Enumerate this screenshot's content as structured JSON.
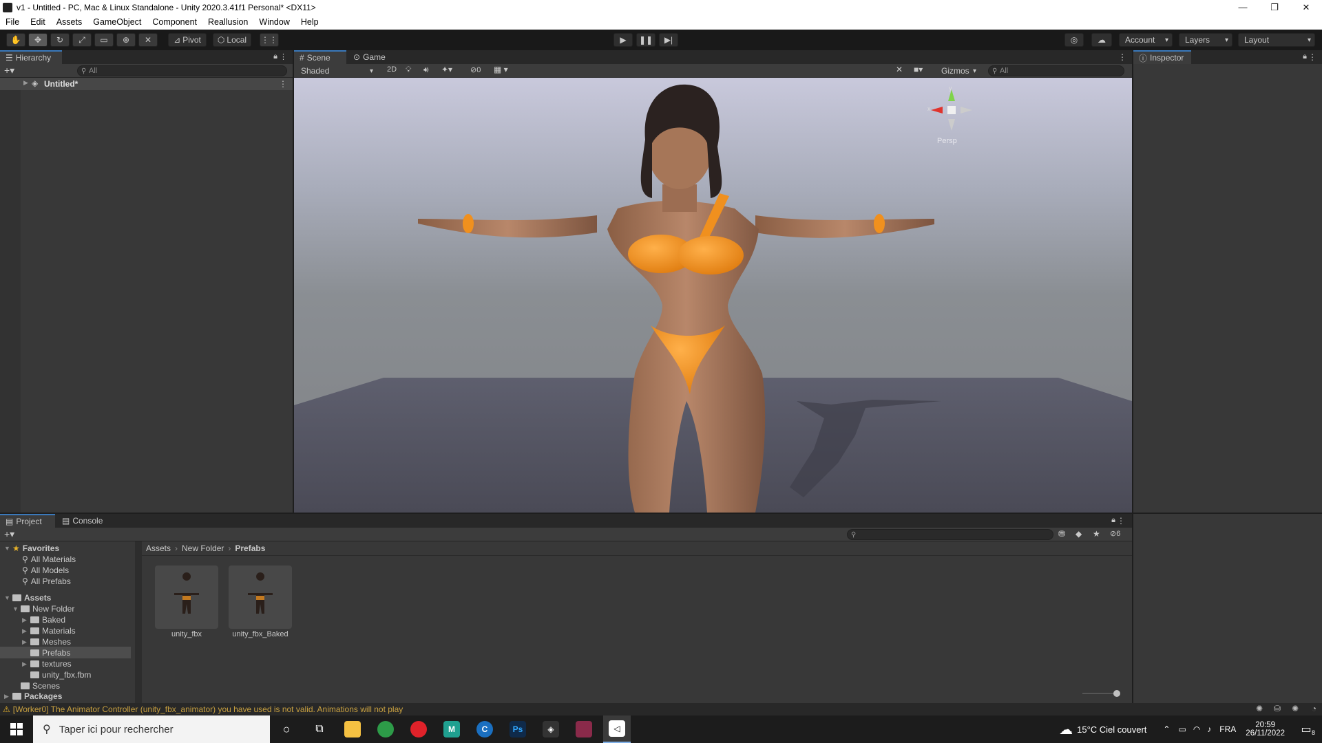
{
  "window": {
    "title": "v1 - Untitled - PC, Mac & Linux Standalone - Unity 2020.3.41f1 Personal* <DX11>",
    "minimize": "—",
    "maximize": "❐",
    "close": "✕"
  },
  "menu": [
    "File",
    "Edit",
    "Assets",
    "GameObject",
    "Component",
    "Reallusion",
    "Window",
    "Help"
  ],
  "toolbar": {
    "pivot_label": "Pivot",
    "local_label": "Local",
    "account_label": "Account",
    "layers_label": "Layers",
    "layout_label": "Layout"
  },
  "hierarchy": {
    "tab_label": "Hierarchy",
    "search_placeholder": "All",
    "root_item": "Untitled*"
  },
  "scene_view": {
    "tab_scene": "Scene",
    "tab_game": "Game",
    "shading_mode": "Shaded",
    "mode_2d": "2D",
    "hidden_count": "0",
    "gizmos_label": "Gizmos",
    "search_placeholder": "All",
    "persp_label": "Persp",
    "axis_x": "x",
    "axis_y": "y"
  },
  "inspector": {
    "tab_label": "Inspector"
  },
  "project": {
    "tab_project": "Project",
    "tab_console": "Console",
    "hidden_count": "6",
    "breadcrumb": [
      "Assets",
      "New Folder",
      "Prefabs"
    ],
    "favorites_label": "Favorites",
    "favorites": [
      "All Materials",
      "All Models",
      "All Prefabs"
    ],
    "assets_label": "Assets",
    "new_folder_label": "New Folder",
    "subfolders": [
      "Baked",
      "Materials",
      "Meshes",
      "Prefabs",
      "textures",
      "unity_fbx.fbm"
    ],
    "scenes_label": "Scenes",
    "packages_label": "Packages",
    "items": [
      {
        "name": "unity_fbx"
      },
      {
        "name": "unity_fbx_Baked"
      }
    ]
  },
  "status": {
    "message": "[Worker0] The Animator Controller (unity_fbx_animator) you have used is not valid. Animations will not play"
  },
  "taskbar": {
    "search_placeholder": "Taper ici pour rechercher",
    "weather": "15°C Ciel couvert",
    "language": "FRA",
    "time": "20:59",
    "date": "26/11/2022",
    "notifications_count": "8"
  },
  "colors": {
    "accent": "#3a79bb",
    "swimsuit": "#f0901e",
    "skin": "#a67658",
    "warning": "#e8b32a"
  }
}
